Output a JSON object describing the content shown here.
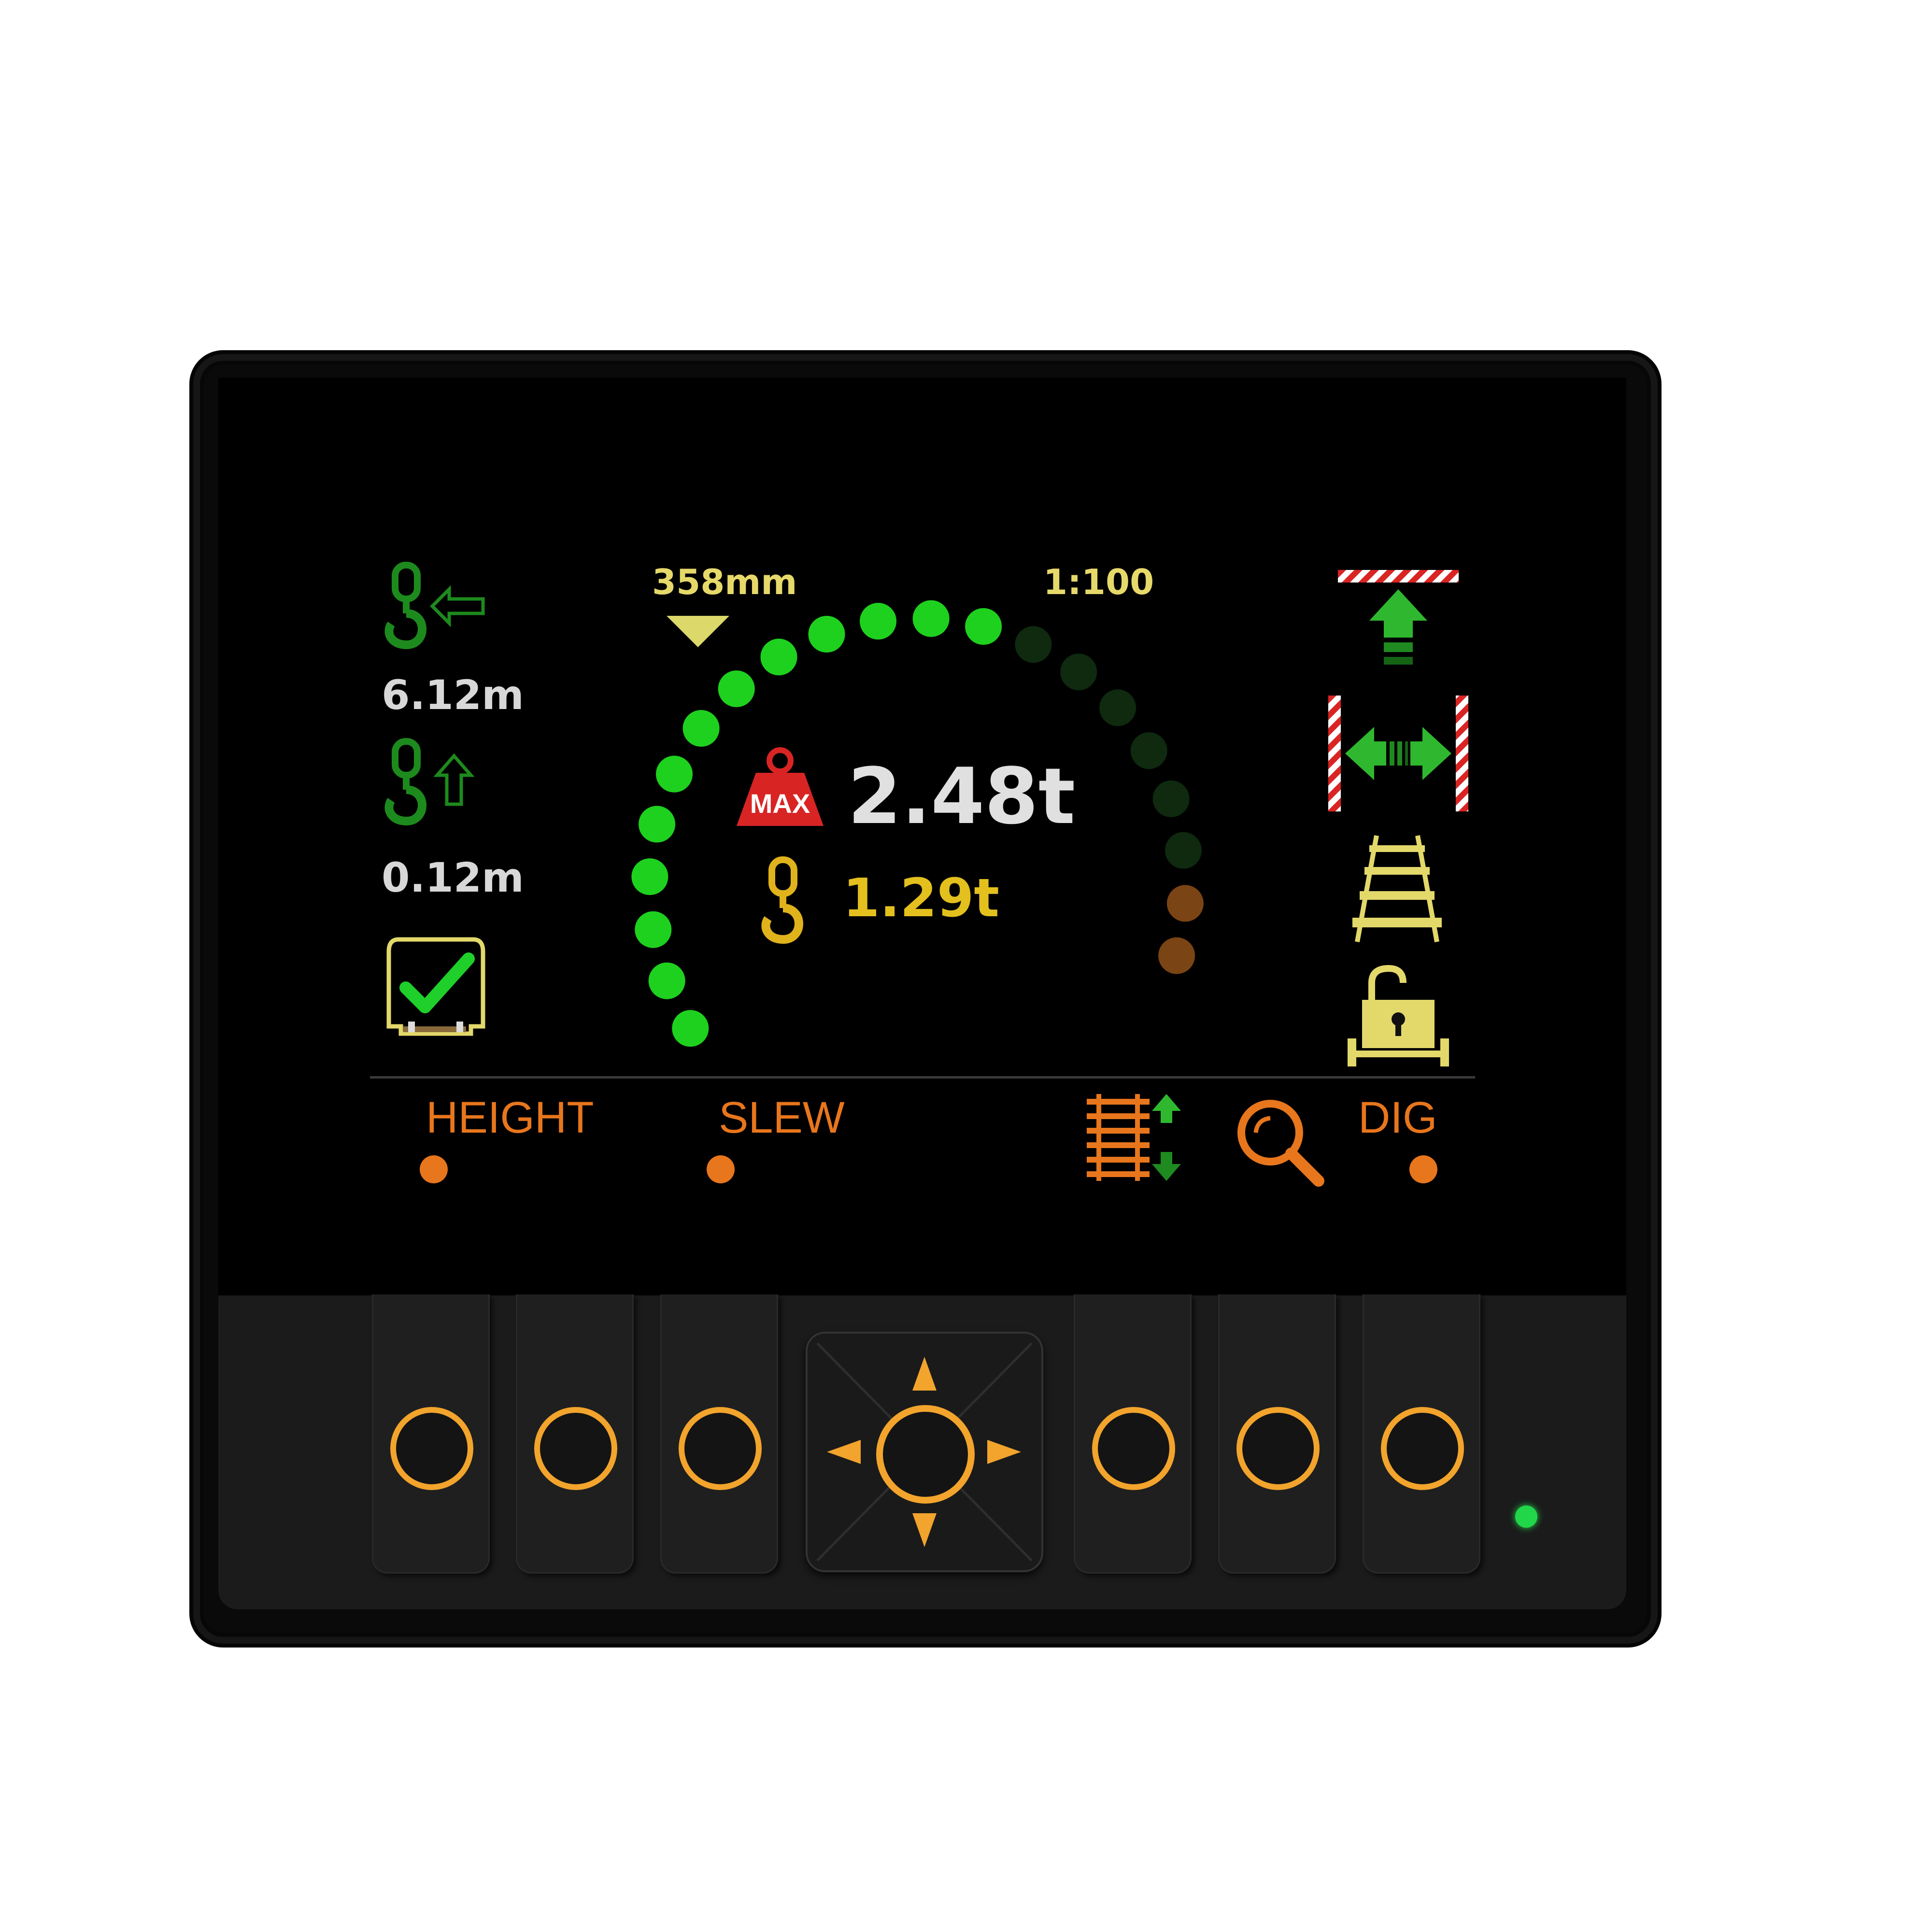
{
  "readouts": {
    "hook_radius": "6.12m",
    "hook_height": "0.12m",
    "arc_top_left": "358mm",
    "arc_top_right": "1:100",
    "max_load": "2.48t",
    "hook_load": "1.29t"
  },
  "softkeys": {
    "height_label": "HEIGHT",
    "slew_label": "SLEW",
    "dig_label": "DIG"
  },
  "load_arc": {
    "total_segments": 21,
    "lit_green_segments": 13,
    "amber_segments": 2
  },
  "icons": {
    "hook_radius": "hook-radius-icon",
    "hook_height": "hook-height-icon",
    "rail_check": "rail-check-icon",
    "max_weight": "max-weight-icon",
    "hook_load": "hook-load-icon",
    "height_limit": "height-limit-icon",
    "width_limit": "width-limit-icon",
    "rail_track": "rail-track-icon",
    "rail_lock": "rail-lock-icon",
    "rail_adjust": "rail-adjust-icon",
    "zoom": "zoom-icon"
  },
  "colors": {
    "green_lit": "#1ed11e",
    "green_dim": "#0f2a0f",
    "amber": "#7a4414",
    "orange_label": "#e8761c",
    "yellow_label": "#e6d96a",
    "key_ring": "#f2a42c",
    "led": "#22d64a"
  }
}
